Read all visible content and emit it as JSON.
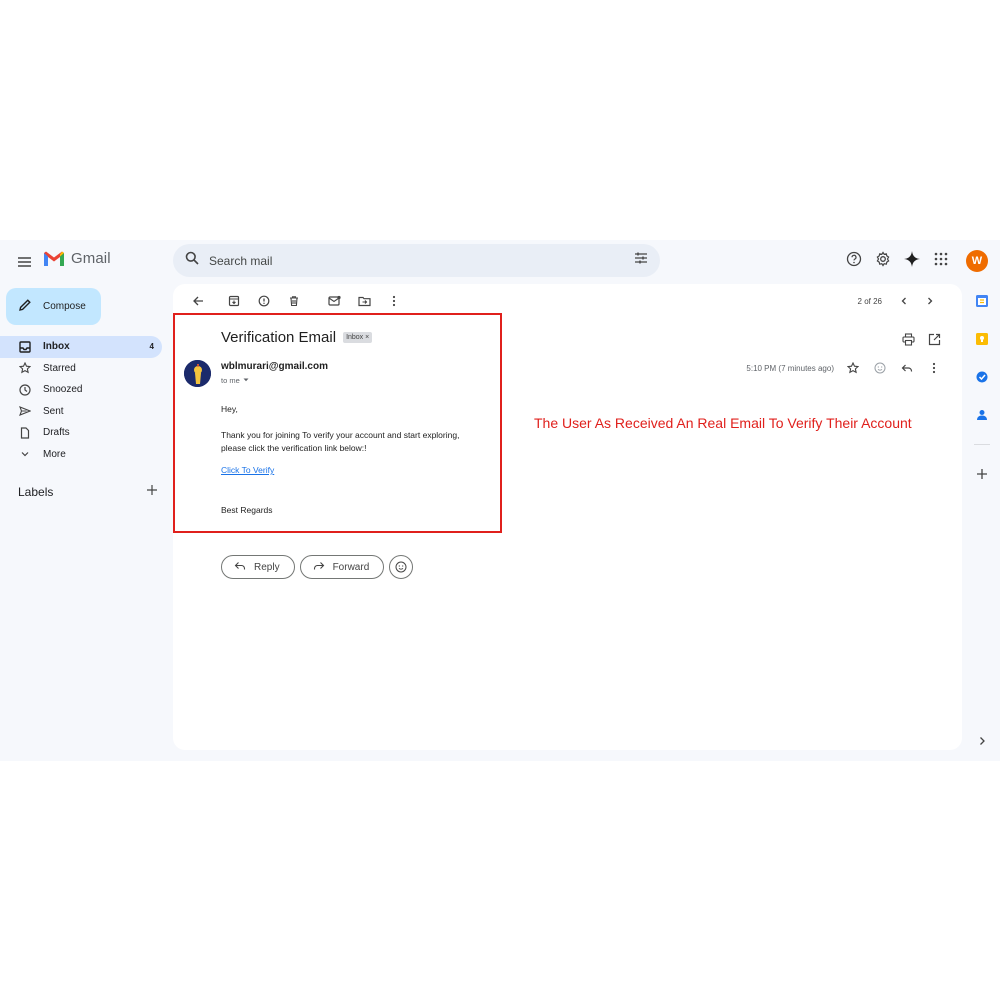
{
  "header": {
    "app_name": "Gmail",
    "search_placeholder": "Search mail",
    "avatar_letter": "W"
  },
  "sidebar": {
    "compose_label": "Compose",
    "items": [
      {
        "label": "Inbox",
        "count": "4",
        "icon": "inbox-icon"
      },
      {
        "label": "Starred",
        "icon": "star-icon"
      },
      {
        "label": "Snoozed",
        "icon": "clock-icon"
      },
      {
        "label": "Sent",
        "icon": "send-icon"
      },
      {
        "label": "Drafts",
        "icon": "draft-icon"
      },
      {
        "label": "More",
        "icon": "chevron-down-icon"
      }
    ],
    "labels_title": "Labels"
  },
  "pager": {
    "text": "2 of 26"
  },
  "email": {
    "subject": "Verification Email",
    "label_chip": "Inbox ×",
    "sender": "wblmurari@gmail.com",
    "recipient": "to me",
    "time": "5:10 PM (7 minutes ago)",
    "greeting": "Hey,",
    "line1": "Thank you for joining To verify your account and start exploring,",
    "line2": "please click the verification link below:!",
    "link_text": "Click To Verify",
    "signoff": "Best Regards"
  },
  "annotation": "The User As Received An Real Email To Verify Their Account",
  "actions": {
    "reply": "Reply",
    "forward": "Forward"
  },
  "colors": {
    "accent": "#c2e7ff",
    "highlight": "#e0201c",
    "active_nav": "#d3e3fd",
    "avatar": "#ef6c00"
  }
}
